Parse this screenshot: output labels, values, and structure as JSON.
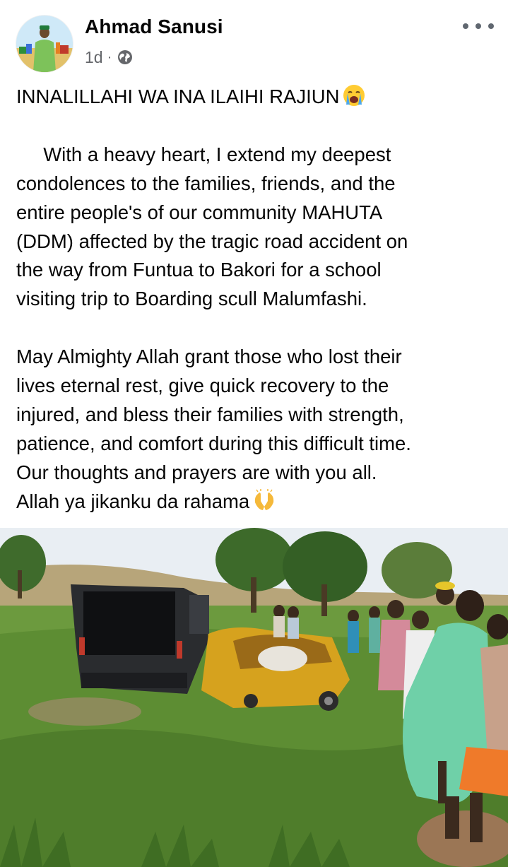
{
  "post": {
    "author": {
      "name": "Ahmad Sanusi"
    },
    "meta": {
      "timestamp": "1d",
      "separator": "·",
      "audience_icon": "globe-icon"
    },
    "menu_icon": "more-dots-icon",
    "title_line": "INNALILLAHI WA INA ILAIHI RAJIUN",
    "title_emoji": "loudly-crying-face-emoji",
    "paragraph1": [
      "With a heavy heart, I extend my deepest",
      "condolences to the families, friends, and the",
      "entire people's of our community MAHUTA",
      "(DDM) affected by the tragic road accident on",
      "the way from Funtua to Bakori for a school",
      "visiting trip to Boarding scull Malumfashi."
    ],
    "paragraph2": [
      "May Almighty Allah grant those who lost their",
      "lives eternal rest, give quick recovery to the",
      "injured, and bless their families with strength,",
      "patience, and comfort during this difficult time.",
      "Our thoughts and prayers are with you all.",
      "Allah ya jikanku da rahama"
    ],
    "closing_emoji": "raised-hands-emoji",
    "photo": {
      "icon": "accident-scene-photo"
    }
  },
  "colors": {
    "text_primary": "#050505",
    "text_secondary": "#65676b",
    "background": "#ffffff"
  }
}
